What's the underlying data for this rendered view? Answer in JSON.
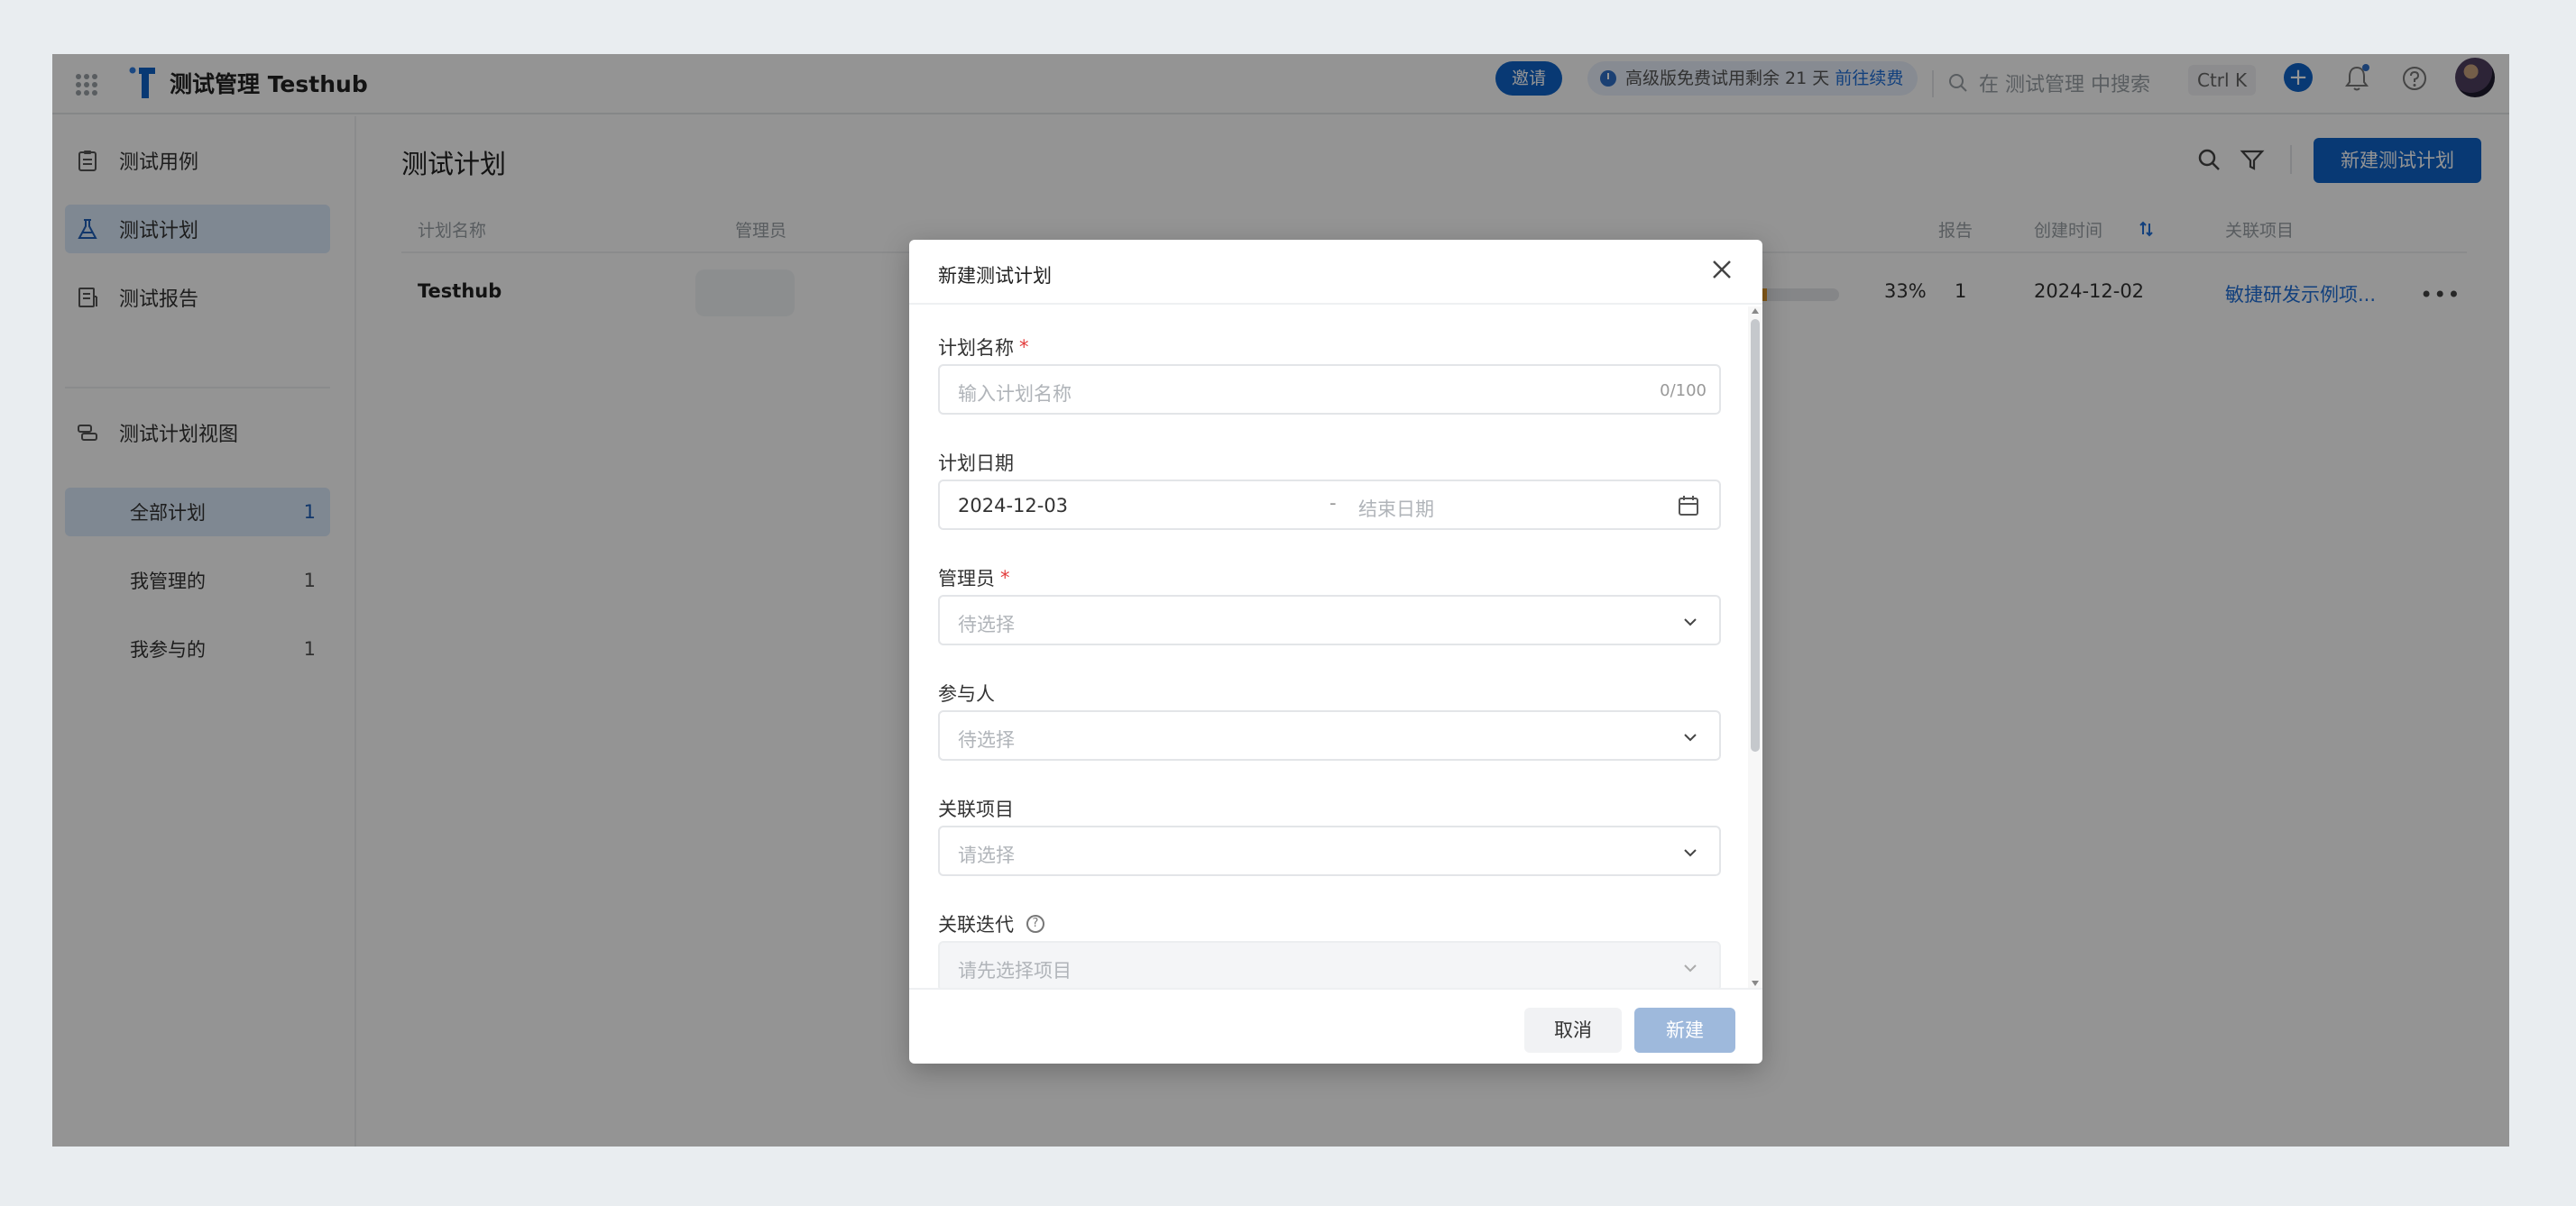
{
  "app": {
    "title": "测试管理 Testhub",
    "invite_label": "邀请",
    "trial_text": "高级版免费试用剩余 21 天",
    "trial_link": "前往续费",
    "search_placeholder": "在 测试管理 中搜索",
    "shortcut": "Ctrl K",
    "accent_color": "#0e63c9"
  },
  "sidebar": {
    "items": [
      {
        "label": "测试用例",
        "icon": "clipboard-icon"
      },
      {
        "label": "测试计划",
        "icon": "flask-icon"
      },
      {
        "label": "测试报告",
        "icon": "report-icon"
      },
      {
        "label": "测试计划视图",
        "icon": "layers-icon"
      }
    ],
    "views": [
      {
        "label": "全部计划",
        "count": "1"
      },
      {
        "label": "我管理的",
        "count": "1"
      },
      {
        "label": "我参与的",
        "count": "1"
      }
    ]
  },
  "main": {
    "title": "测试计划",
    "new_button": "新建测试计划",
    "columns": [
      "计划名称",
      "管理员",
      "报告",
      "创建时间",
      "关联项目"
    ],
    "rows": [
      {
        "name": "Testhub",
        "progress_percent": 33,
        "progress_text": "33%",
        "reports": "1",
        "created": "2024-12-02",
        "project": "敏捷研发示例项..."
      }
    ]
  },
  "modal": {
    "title": "新建测试计划",
    "fields": {
      "name": {
        "label": "计划名称",
        "placeholder": "输入计划名称",
        "counter": "0/100"
      },
      "date": {
        "label": "计划日期",
        "start": "2024-12-03",
        "separator": "-",
        "end_placeholder": "结束日期"
      },
      "admin": {
        "label": "管理员",
        "placeholder": "待选择"
      },
      "participants": {
        "label": "参与人",
        "placeholder": "待选择"
      },
      "project": {
        "label": "关联项目",
        "placeholder": "请选择"
      },
      "iteration": {
        "label": "关联迭代",
        "placeholder": "请先选择项目"
      }
    },
    "cancel": "取消",
    "create": "新建"
  }
}
